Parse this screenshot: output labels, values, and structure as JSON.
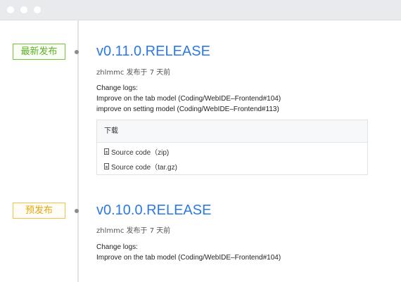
{
  "window": {
    "controls": [
      "close",
      "minimize",
      "maximize"
    ]
  },
  "releases": [
    {
      "badge": "最新发布",
      "badge_kind": "latest",
      "version": "v0.11.0.RELEASE",
      "meta": "zhlmmc 发布于 7 天前",
      "changelog_title": "Change logs:",
      "changes": [
        "Improve on the tab model (Coding/WebIDE–Frontend#104)",
        "improve on setting model (Coding/WebIDE–Frontend#113)"
      ],
      "downloads": {
        "header": "下载",
        "items": [
          "Source code（zip)",
          "Source code（tar.gz)"
        ]
      }
    },
    {
      "badge": "预发布",
      "badge_kind": "pre",
      "version": "v0.10.0.RELEASE",
      "meta": "zhlmmc 发布于 7 天前",
      "changelog_title": "Change logs:",
      "changes": [
        "Improve on the tab model (Coding/WebIDE–Frontend#104)"
      ]
    }
  ],
  "colors": {
    "version_link": "#2b79e3",
    "latest_badge": "#5fad2a",
    "pre_badge": "#e0a512"
  }
}
